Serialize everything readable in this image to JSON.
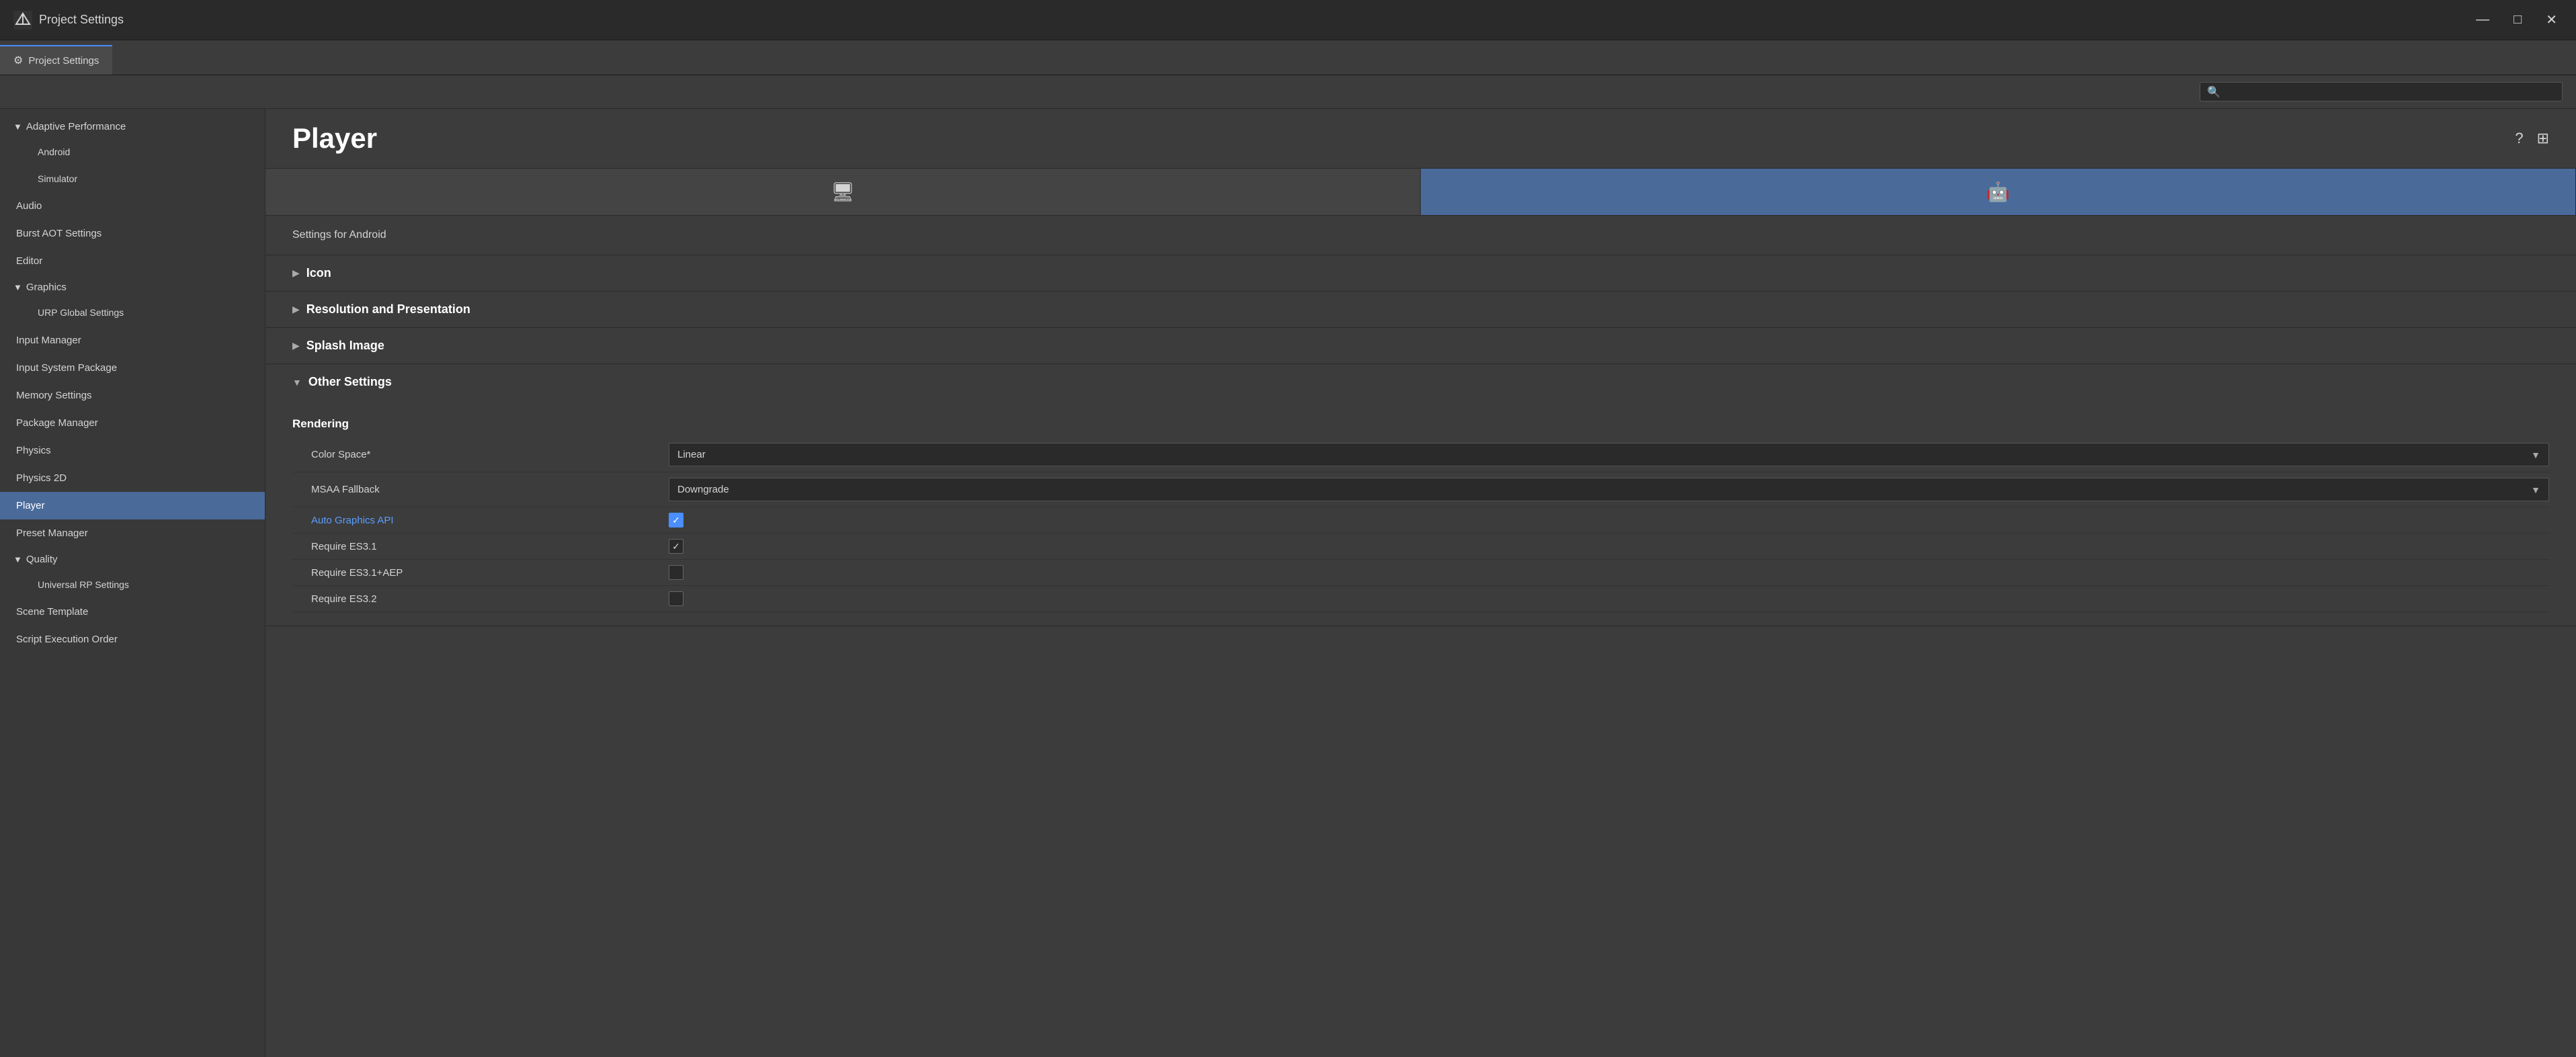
{
  "titleBar": {
    "title": "Project Settings",
    "icon": "⚙",
    "minimizeBtn": "—",
    "restoreBtn": "□",
    "closeBtn": "✕"
  },
  "tabBar": {
    "activeTab": "Project Settings",
    "tabs": [
      {
        "label": "Project Settings",
        "icon": "⚙"
      }
    ]
  },
  "search": {
    "placeholder": ""
  },
  "sidebar": {
    "items": [
      {
        "id": "adaptive-performance",
        "label": "Adaptive Performance",
        "type": "section-header",
        "expanded": true
      },
      {
        "id": "android",
        "label": "Android",
        "type": "child"
      },
      {
        "id": "simulator",
        "label": "Simulator",
        "type": "child"
      },
      {
        "id": "audio",
        "label": "Audio",
        "type": "item"
      },
      {
        "id": "burst-aot",
        "label": "Burst AOT Settings",
        "type": "item"
      },
      {
        "id": "editor",
        "label": "Editor",
        "type": "item"
      },
      {
        "id": "graphics",
        "label": "Graphics",
        "type": "section-header",
        "expanded": true
      },
      {
        "id": "urp-global",
        "label": "URP Global Settings",
        "type": "child"
      },
      {
        "id": "input-manager",
        "label": "Input Manager",
        "type": "item"
      },
      {
        "id": "input-system",
        "label": "Input System Package",
        "type": "item"
      },
      {
        "id": "memory-settings",
        "label": "Memory Settings",
        "type": "item"
      },
      {
        "id": "package-manager",
        "label": "Package Manager",
        "type": "item"
      },
      {
        "id": "physics",
        "label": "Physics",
        "type": "item"
      },
      {
        "id": "physics-2d",
        "label": "Physics 2D",
        "type": "item"
      },
      {
        "id": "player",
        "label": "Player",
        "type": "item",
        "active": true
      },
      {
        "id": "preset-manager",
        "label": "Preset Manager",
        "type": "item"
      },
      {
        "id": "quality",
        "label": "Quality",
        "type": "section-header",
        "expanded": true
      },
      {
        "id": "universal-rp",
        "label": "Universal RP Settings",
        "type": "child"
      },
      {
        "id": "scene-template",
        "label": "Scene Template",
        "type": "item"
      },
      {
        "id": "script-execution",
        "label": "Script Execution Order",
        "type": "item"
      }
    ]
  },
  "content": {
    "title": "Player",
    "helpIcon": "?",
    "layoutIcon": "⊞",
    "settingsFor": "Settings for Android",
    "platformTabs": [
      {
        "id": "standalone",
        "icon": "🖥",
        "label": "Standalone",
        "active": false
      },
      {
        "id": "android",
        "icon": "🤖",
        "label": "Android",
        "active": true
      }
    ],
    "sections": [
      {
        "id": "icon",
        "title": "Icon",
        "expanded": false,
        "arrow": "▶"
      },
      {
        "id": "resolution",
        "title": "Resolution and Presentation",
        "expanded": false,
        "arrow": "▶"
      },
      {
        "id": "splash",
        "title": "Splash Image",
        "expanded": false,
        "arrow": "▶"
      },
      {
        "id": "other",
        "title": "Other Settings",
        "expanded": true,
        "arrow": "▼",
        "subSections": [
          {
            "id": "rendering",
            "title": "Rendering",
            "fields": [
              {
                "id": "color-space",
                "label": "Color Space*",
                "type": "dropdown",
                "value": "Linear"
              },
              {
                "id": "msaa-fallback",
                "label": "MSAA Fallback",
                "type": "dropdown",
                "value": "Downgrade"
              },
              {
                "id": "auto-graphics-api",
                "label": "Auto Graphics API",
                "type": "checkbox",
                "checked": true,
                "isLink": true
              },
              {
                "id": "require-es31",
                "label": "Require ES3.1",
                "type": "checkbox",
                "checked": true,
                "isLink": false
              },
              {
                "id": "require-es31-aep",
                "label": "Require ES3.1+AEP",
                "type": "checkbox",
                "checked": false,
                "isLink": false
              },
              {
                "id": "require-es32",
                "label": "Require ES3.2",
                "type": "checkbox",
                "checked": false,
                "isLink": false
              }
            ]
          }
        ]
      }
    ]
  }
}
